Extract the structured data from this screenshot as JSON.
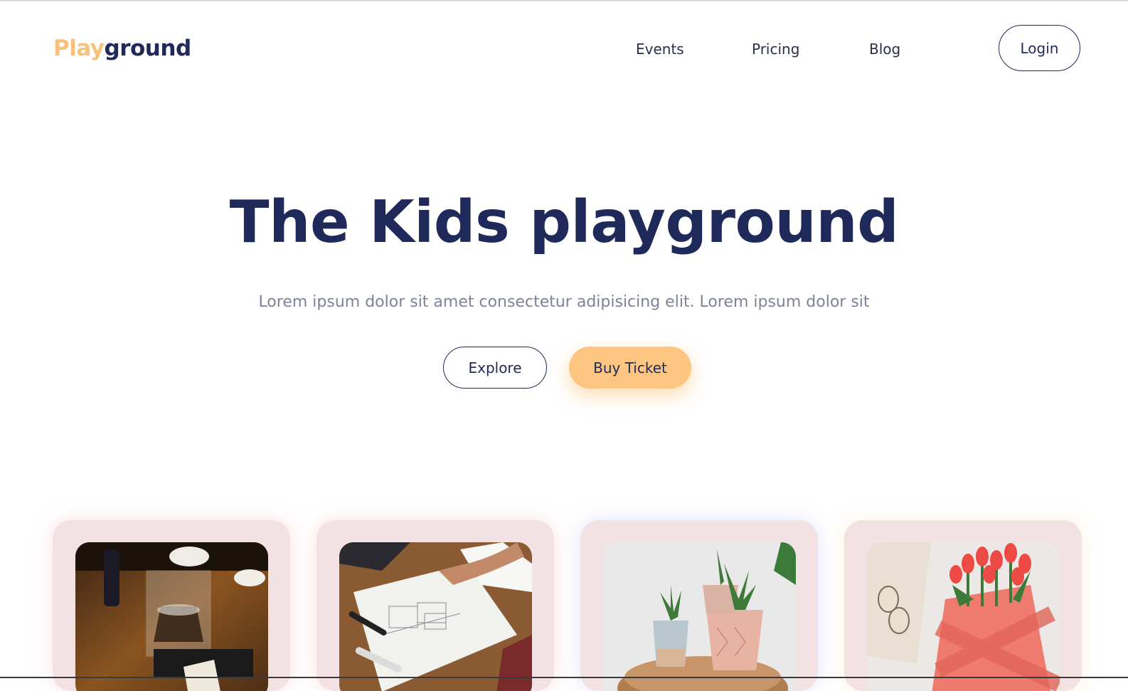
{
  "logo": {
    "part1": "Play",
    "part2": "ground"
  },
  "nav": {
    "events": "Events",
    "pricing": "Pricing",
    "blog": "Blog",
    "login": "Login"
  },
  "hero": {
    "title": "The Kids playground",
    "subtitle": "Lorem ipsum dolor sit amet consectetur adipisicing elit. Lorem ipsum dolor sit",
    "explore": "Explore",
    "buy_ticket": "Buy Ticket"
  },
  "colors": {
    "navy": "#1f2a5a",
    "accent": "#fcc681",
    "logo_play": "#f8c27c",
    "card_bg": "#f3e2e3",
    "muted_text": "#7f8398"
  },
  "cards": [
    {
      "image": "coffee-brewing-photo"
    },
    {
      "image": "architect-sketch-photo"
    },
    {
      "image": "potted-plants-photo"
    },
    {
      "image": "tulips-in-knit-photo"
    }
  ]
}
